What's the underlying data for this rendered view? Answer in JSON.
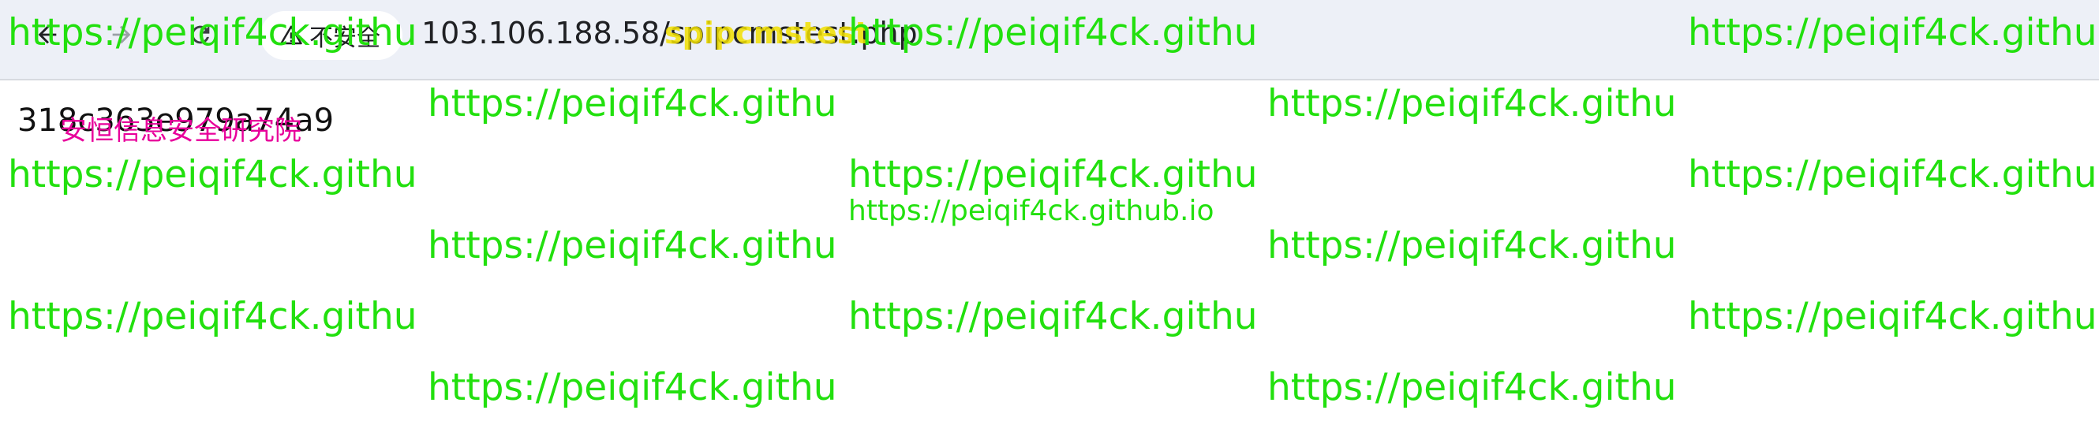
{
  "browser": {
    "security_label": "不安全",
    "url": "103.106.188.58/spipcmstest.php",
    "url_overlay_text": "spipcmstest",
    "icons": {
      "back": "back-arrow-icon",
      "forward": "forward-arrow-icon",
      "reload": "reload-icon",
      "security": "warning-triangle-icon"
    }
  },
  "page": {
    "id_text": "318c363e979a74a9",
    "overlay_text": "安恒信息安全研究院"
  },
  "watermark": {
    "text": "https://peiqif4ck.githu",
    "small_text": "https://peiqif4ck.github.io",
    "color": "#22e00e"
  }
}
